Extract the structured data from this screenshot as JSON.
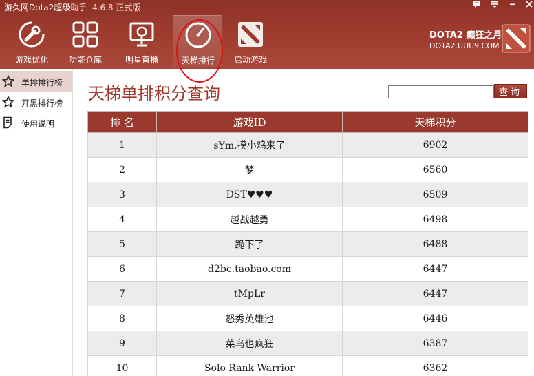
{
  "window": {
    "title": "游久网Dota2超级助手",
    "version": "4.6.8 正式版",
    "controls": [
      "feedback-icon",
      "menu-icon",
      "minimize-icon",
      "close-icon"
    ]
  },
  "toolbar": {
    "items": [
      {
        "label": "游戏优化",
        "icon": "wrench-icon"
      },
      {
        "label": "功能仓库",
        "icon": "grid-icon"
      },
      {
        "label": "明星直播",
        "icon": "broadcast-icon"
      },
      {
        "label": "天梯排行",
        "icon": "gauge-icon",
        "active": true
      },
      {
        "label": "启动游戏",
        "icon": "dota-logo-icon"
      }
    ]
  },
  "brand": {
    "line1": "DOTA2 癫狂之月",
    "line2": "DOTA2.UUU9.COM"
  },
  "sidebar": {
    "items": [
      {
        "label": "单排排行榜",
        "icon": "star-icon",
        "selected": true
      },
      {
        "label": "开黑排行榜",
        "icon": "star-icon"
      },
      {
        "label": "使用说明",
        "icon": "document-icon"
      }
    ]
  },
  "main": {
    "title": "天梯单排积分查询",
    "search": {
      "value": "",
      "placeholder": "",
      "button_label": "查询"
    },
    "table": {
      "headers": [
        "排 名",
        "游戏ID",
        "天梯积分"
      ],
      "rows": [
        {
          "rank": "1",
          "id": "sYm.摸小鸡来了",
          "score": "6902"
        },
        {
          "rank": "2",
          "id": "梦",
          "score": "6560"
        },
        {
          "rank": "3",
          "id": "DST♥♥♥",
          "score": "6509"
        },
        {
          "rank": "4",
          "id": "越战越勇",
          "score": "6498"
        },
        {
          "rank": "5",
          "id": "跪下了",
          "score": "6488"
        },
        {
          "rank": "6",
          "id": "d2bc.taobao.com",
          "score": "6447"
        },
        {
          "rank": "7",
          "id": "tMpLr",
          "score": "6447"
        },
        {
          "rank": "8",
          "id": "怒秀英雄池",
          "score": "6446"
        },
        {
          "rank": "9",
          "id": "菜鸟也疯狂",
          "score": "6387"
        },
        {
          "rank": "10",
          "id": "Solo Rank Warrior",
          "score": "6362"
        }
      ]
    }
  },
  "colors": {
    "header": "#9c3a2e",
    "accent": "#a1382c",
    "table_header": "#9a3a2e",
    "row_alt": "#ececec",
    "annotation": "#e01010"
  }
}
